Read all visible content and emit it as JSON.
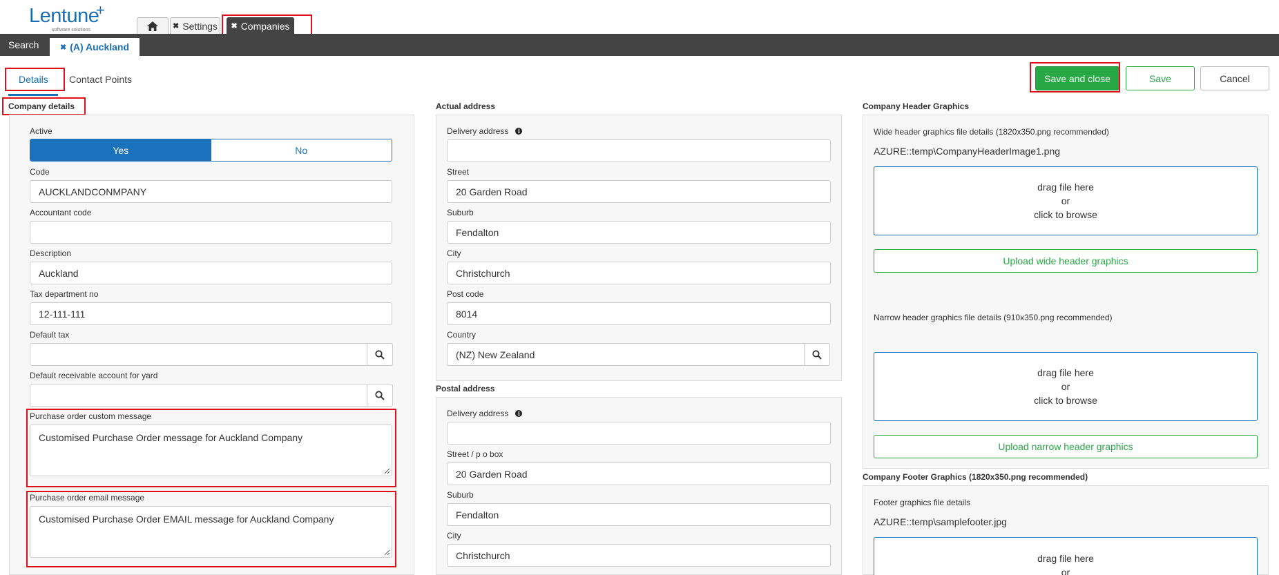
{
  "logo": {
    "name": "Lentune",
    "plus": "+",
    "tagline": "software solutions"
  },
  "top_tabs": {
    "home_icon": "home-icon",
    "settings": "Settings",
    "companies": "Companies"
  },
  "dark_bar": {
    "search": "Search",
    "record_tab": "(A) Auckland"
  },
  "sub_tabs": {
    "details": "Details",
    "contact_points": "Contact Points"
  },
  "actions": {
    "save_and_close": "Save and close",
    "save": "Save",
    "cancel": "Cancel"
  },
  "company": {
    "title": "Company details",
    "active_label": "Active",
    "active_yes": "Yes",
    "active_no": "No",
    "code_label": "Code",
    "code": "AUCKLANDCONMPANY",
    "accountant_code_label": "Accountant code",
    "accountant_code": "",
    "description_label": "Description",
    "description": "Auckland",
    "tax_dept_label": "Tax department no",
    "tax_dept": "12-111-111",
    "default_tax_label": "Default tax",
    "default_tax": "",
    "default_recv_label": "Default receivable account for yard",
    "default_recv": "",
    "po_custom_label": "Purchase order custom message",
    "po_custom": "Customised Purchase Order message for Auckland Company",
    "po_email_label": "Purchase order email message",
    "po_email": "Customised Purchase Order EMAIL message for Auckland Company"
  },
  "actual_address": {
    "title": "Actual address",
    "delivery_label": "Delivery address",
    "delivery": "",
    "street_label": "Street",
    "street": "20 Garden Road",
    "suburb_label": "Suburb",
    "suburb": "Fendalton",
    "city_label": "City",
    "city": "Christchurch",
    "postcode_label": "Post code",
    "postcode": "8014",
    "country_label": "Country",
    "country": "(NZ) New Zealand"
  },
  "postal_address": {
    "title": "Postal address",
    "delivery_label": "Delivery address",
    "delivery": "",
    "street_label": "Street / p o box",
    "street": "20 Garden Road",
    "suburb_label": "Suburb",
    "suburb": "Fendalton",
    "city_label": "City",
    "city": "Christchurch"
  },
  "header_graphics": {
    "title": "Company Header Graphics",
    "wide_hint": "Wide header graphics file details (1820x350.png recommended)",
    "wide_file": "AZURE::temp\\CompanyHeaderImage1.png",
    "narrow_hint": "Narrow header graphics file details (910x350.png recommended)",
    "drop_line1": "drag file here",
    "drop_line2": "or",
    "drop_line3": "click to browse",
    "upload_wide": "Upload wide header graphics",
    "upload_narrow": "Upload narrow header graphics"
  },
  "footer_graphics": {
    "title": "Company Footer Graphics (1820x350.png recommended)",
    "hint": "Footer graphics file details",
    "file": "AZURE::temp\\samplefooter.jpg",
    "drop_line1": "drag file here",
    "drop_line2": "or"
  },
  "colors": {
    "brand": "#1a6fb4",
    "save_green": "#27a844",
    "highlight_red": "#e0101a",
    "dark_bar": "#444444"
  }
}
